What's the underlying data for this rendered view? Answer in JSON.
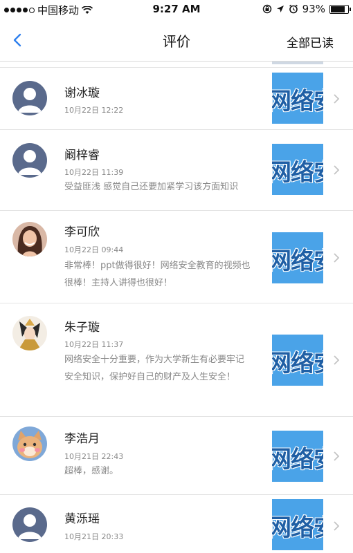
{
  "status_bar": {
    "carrier": "中国移动",
    "time": "9:27 AM",
    "battery": "93%",
    "battery_level": 0.93,
    "signal_icon": "signal-dots-icon",
    "wifi_icon": "wifi-icon"
  },
  "nav": {
    "title": "评价",
    "action_label": "全部已读",
    "back_icon": "chevron-left-icon",
    "accent_color": "#2f80ed"
  },
  "items": [
    {
      "name": "谢冰璇",
      "date": "10月22日 12:22",
      "comment": "",
      "avatar": "default-avatar",
      "thumb_text": "网络安"
    },
    {
      "name": "阚梓睿",
      "date": "10月22日 11:39",
      "comment": "受益匪浅 感觉自己还要加紧学习该方面知识",
      "avatar": "default-avatar",
      "thumb_text": "网络安"
    },
    {
      "name": "李可欣",
      "date": "10月22日 09:44",
      "comment": "非常棒！ppt做得很好！网络安全教育的视频也很棒！主持人讲得也很好！",
      "avatar": "photo-woman",
      "thumb_text": "网络安"
    },
    {
      "name": "朱子璇",
      "date": "10月22日 11:37",
      "comment": "网络安全十分重要，作为大学新生有必要牢记安全知识，保护好自己的财产及人生安全！",
      "avatar": "photo-anime",
      "thumb_text": "网络安"
    },
    {
      "name": "李浩月",
      "date": "10月21日 22:43",
      "comment": "超棒，感谢。",
      "avatar": "photo-cat",
      "thumb_text": "网络安"
    },
    {
      "name": "黄泺瑶",
      "date": "10月21日 20:33",
      "comment": "",
      "avatar": "default-avatar",
      "thumb_text": "网络安"
    }
  ]
}
